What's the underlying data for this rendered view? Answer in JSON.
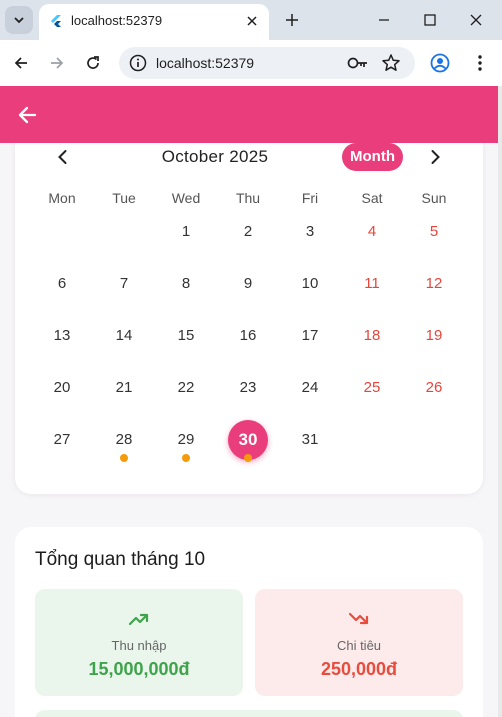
{
  "browser": {
    "tab_title": "localhost:52379",
    "url": "localhost:52379"
  },
  "calendar": {
    "title": "October 2025",
    "view_button": "Month",
    "weekdays": [
      "Mon",
      "Tue",
      "Wed",
      "Thu",
      "Fri",
      "Sat",
      "Sun"
    ],
    "weeks": [
      [
        "",
        "",
        "1",
        "2",
        "3",
        "4",
        "5"
      ],
      [
        "6",
        "7",
        "8",
        "9",
        "10",
        "11",
        "12"
      ],
      [
        "13",
        "14",
        "15",
        "16",
        "17",
        "18",
        "19"
      ],
      [
        "20",
        "21",
        "22",
        "23",
        "24",
        "25",
        "26"
      ],
      [
        "27",
        "28",
        "29",
        "30",
        "31",
        "",
        ""
      ]
    ],
    "today": "30",
    "days_with_transactions": [
      "28",
      "29",
      "30"
    ],
    "colors": {
      "accent": "#ea3d7b",
      "weekend": "#e8443a",
      "dot": "#f59a0a"
    }
  },
  "summary": {
    "title": "Tổng quan tháng 10",
    "income": {
      "label": "Thu nhập",
      "value": "15,000,000đ",
      "icon": "trending-up-icon",
      "color": "#3ea34a"
    },
    "expense": {
      "label": "Chi tiêu",
      "value": "250,000đ",
      "icon": "trending-down-icon",
      "color": "#e84c3d"
    }
  }
}
